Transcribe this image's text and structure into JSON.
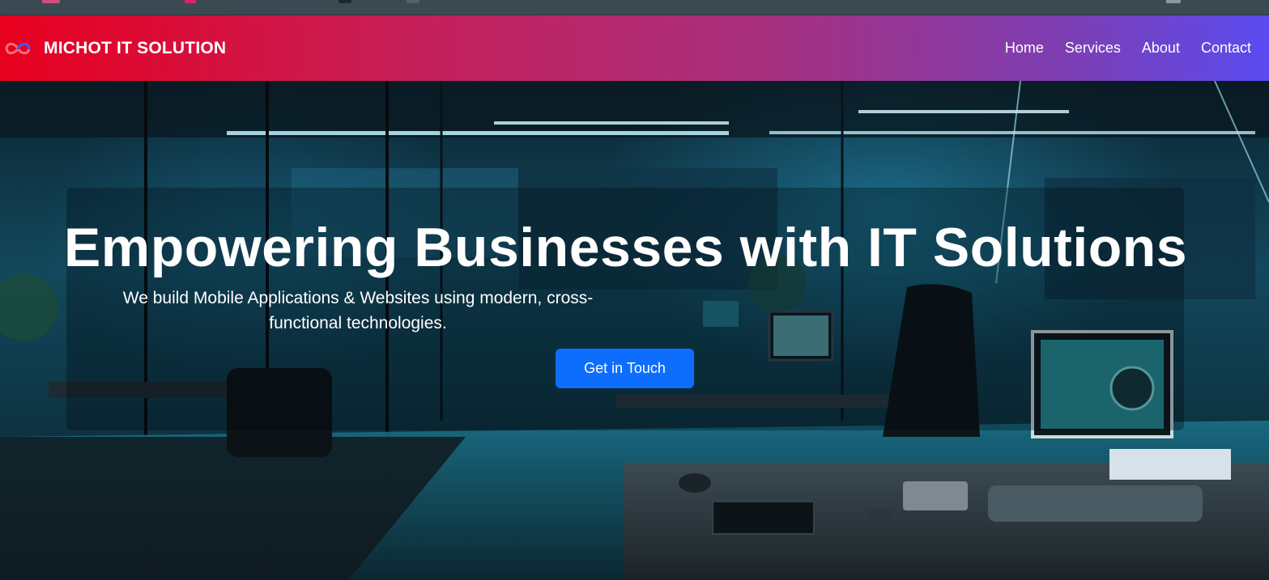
{
  "brand": {
    "name": "MICHOT IT SOLUTION",
    "logo_icon": "infinity-logo-icon"
  },
  "nav": {
    "items": [
      {
        "label": "Home"
      },
      {
        "label": "Services"
      },
      {
        "label": "About"
      },
      {
        "label": "Contact"
      }
    ]
  },
  "hero": {
    "title": "Empowering Businesses with IT Solutions",
    "subtitle": "We build Mobile Applications & Websites using modern, cross-functional technologies.",
    "cta_label": "Get in Touch"
  },
  "colors": {
    "nav_gradient_start": "#e8001f",
    "nav_gradient_end": "#5b4bf0",
    "cta_background": "#0d6efd",
    "hero_text": "#ffffff"
  }
}
